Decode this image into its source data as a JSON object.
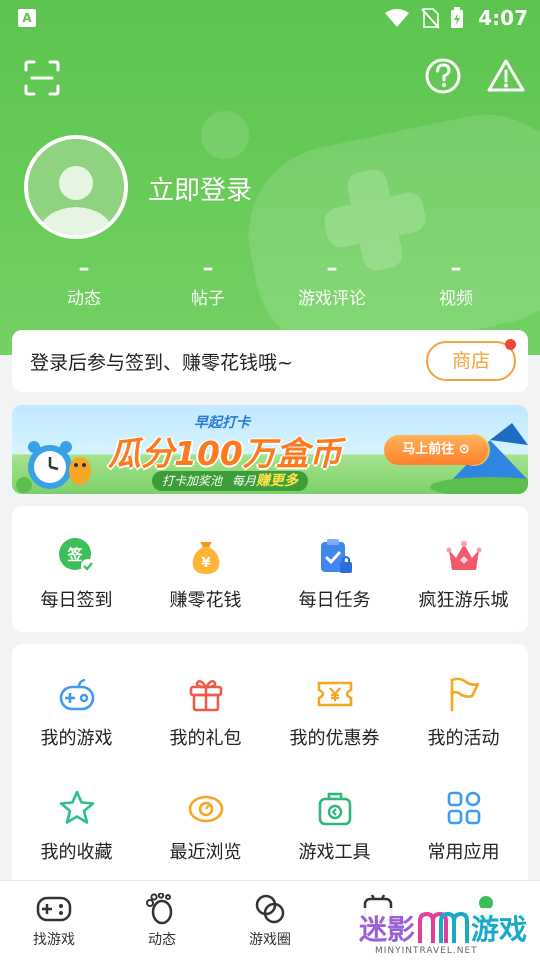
{
  "status_bar": {
    "time": "4:07",
    "left_badge": "A"
  },
  "profile": {
    "login_text": "立即登录",
    "stats": [
      {
        "value": "–",
        "label": "动态"
      },
      {
        "value": "–",
        "label": "帖子"
      },
      {
        "value": "–",
        "label": "游戏评论"
      },
      {
        "value": "–",
        "label": "视频"
      }
    ]
  },
  "signin": {
    "text": "登录后参与签到、赚零花钱哦~",
    "shop_label": "商店"
  },
  "banner": {
    "subtitle": "早起打卡",
    "title": "瓜分100万盒币",
    "pill_left": "打卡加奖池",
    "pill_mid": "每月",
    "pill_highlight": "赚更多",
    "button": "马上前往 ⊙"
  },
  "quick_actions": [
    {
      "label": "每日签到",
      "icon": "sign-in-icon"
    },
    {
      "label": "赚零花钱",
      "icon": "money-bag-icon"
    },
    {
      "label": "每日任务",
      "icon": "task-clipboard-icon"
    },
    {
      "label": "疯狂游乐城",
      "icon": "crown-icon"
    }
  ],
  "my_items": [
    {
      "label": "我的游戏",
      "icon": "gamepad-icon"
    },
    {
      "label": "我的礼包",
      "icon": "gift-icon"
    },
    {
      "label": "我的优惠券",
      "icon": "coupon-icon"
    },
    {
      "label": "我的活动",
      "icon": "flag-icon"
    },
    {
      "label": "我的收藏",
      "icon": "star-icon"
    },
    {
      "label": "最近浏览",
      "icon": "eye-icon"
    },
    {
      "label": "游戏工具",
      "icon": "toolbox-icon"
    },
    {
      "label": "常用应用",
      "icon": "apps-grid-icon"
    }
  ],
  "tabbar": [
    {
      "label": "找游戏",
      "icon": "gamepad-tab-icon"
    },
    {
      "label": "动态",
      "icon": "footprint-icon"
    },
    {
      "label": "游戏圈",
      "icon": "circle-link-icon"
    },
    {
      "label": "",
      "icon": "box-tab-icon"
    },
    {
      "label": "",
      "icon": "profile-tab-icon"
    }
  ],
  "watermark": {
    "brand_left": "迷影",
    "brand_right": "游戏",
    "url": "MINYINTRAVEL.NET"
  },
  "colors": {
    "primary_green": "#5cc44f",
    "accent_orange": "#f5a340",
    "badge_red": "#f0473b"
  }
}
